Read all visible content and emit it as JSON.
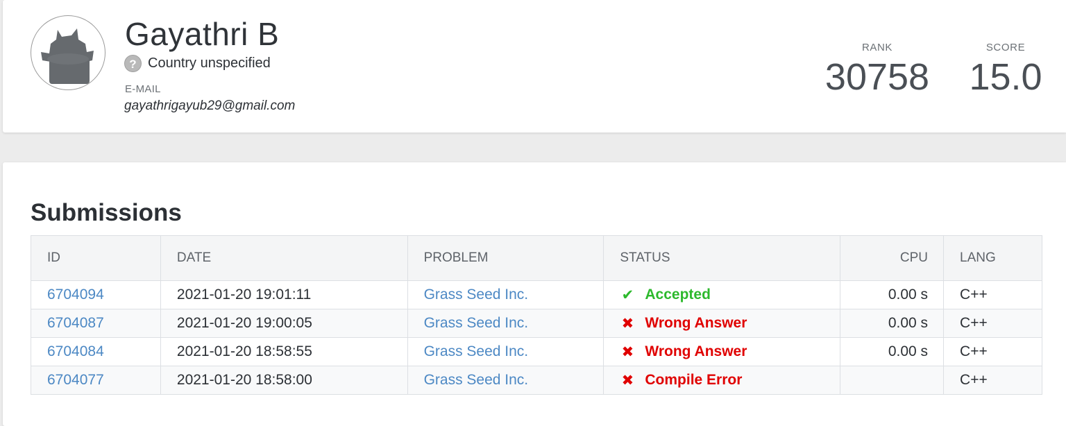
{
  "profile": {
    "name": "Gayathri B",
    "country": "Country unspecified",
    "country_icon": "?",
    "email_label": "E-MAIL",
    "email": "gayathrigayub29@gmail.com",
    "rank_label": "RANK",
    "rank": "30758",
    "score_label": "SCORE",
    "score": "15.0"
  },
  "submissions": {
    "title": "Submissions",
    "columns": {
      "id": "ID",
      "date": "DATE",
      "problem": "PROBLEM",
      "status": "STATUS",
      "cpu": "CPU",
      "lang": "LANG"
    },
    "rows": [
      {
        "id": "6704094",
        "date": "2021-01-20 19:01:11",
        "problem": "Grass Seed Inc.",
        "status_icon": "✔",
        "status": "Accepted",
        "cpu": "0.00 s",
        "lang": "C++"
      },
      {
        "id": "6704087",
        "date": "2021-01-20 19:00:05",
        "problem": "Grass Seed Inc.",
        "status_icon": "✖",
        "status": "Wrong Answer",
        "cpu": "0.00 s",
        "lang": "C++"
      },
      {
        "id": "6704084",
        "date": "2021-01-20 18:58:55",
        "problem": "Grass Seed Inc.",
        "status_icon": "✖",
        "status": "Wrong Answer",
        "cpu": "0.00 s",
        "lang": "C++"
      },
      {
        "id": "6704077",
        "date": "2021-01-20 18:58:00",
        "problem": "Grass Seed Inc.",
        "status_icon": "✖",
        "status": "Compile Error",
        "cpu": "",
        "lang": "C++"
      }
    ]
  },
  "colors": {
    "accepted": "#2db92d",
    "rejected": "#e00000",
    "link": "#4c88c4"
  }
}
